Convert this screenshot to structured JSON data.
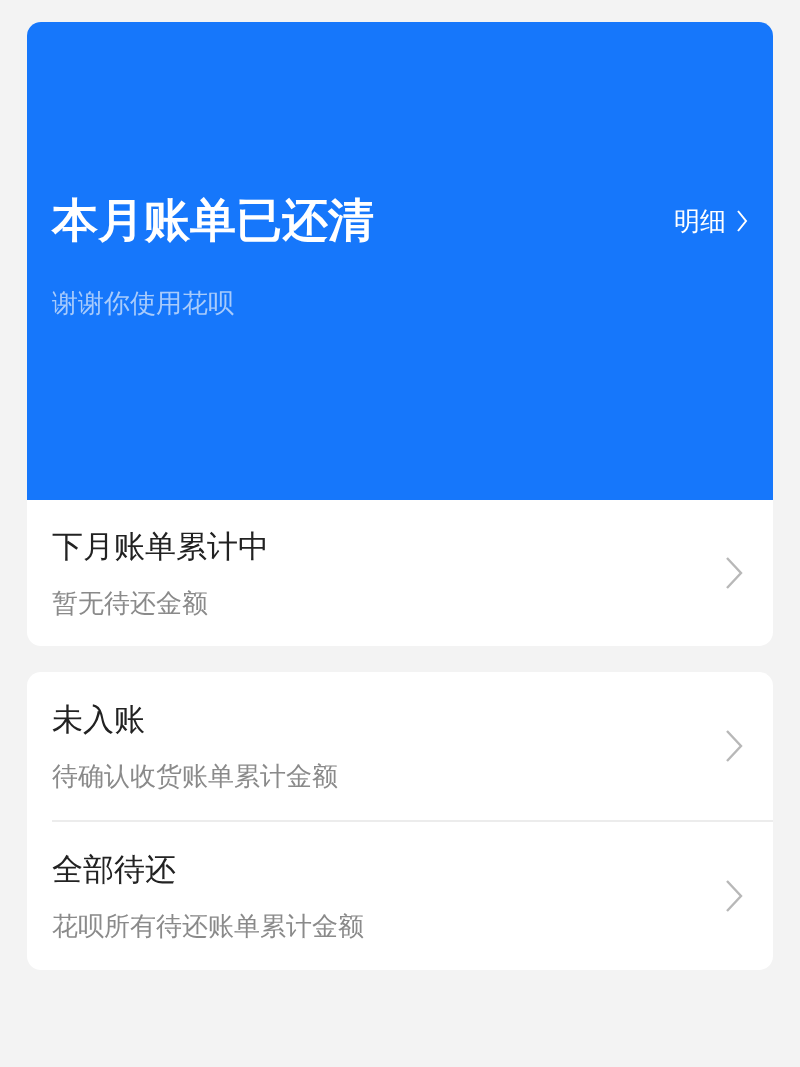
{
  "banner": {
    "title": "本月账单已还清",
    "detail_link": "明细",
    "subtitle": "谢谢你使用花呗"
  },
  "next_bill": {
    "title": "下月账单累计中",
    "subtitle": "暂无待还金额"
  },
  "items": [
    {
      "title": "未入账",
      "subtitle": "待确认收货账单累计金额"
    },
    {
      "title": "全部待还",
      "subtitle": "花呗所有待还账单累计金额"
    }
  ]
}
